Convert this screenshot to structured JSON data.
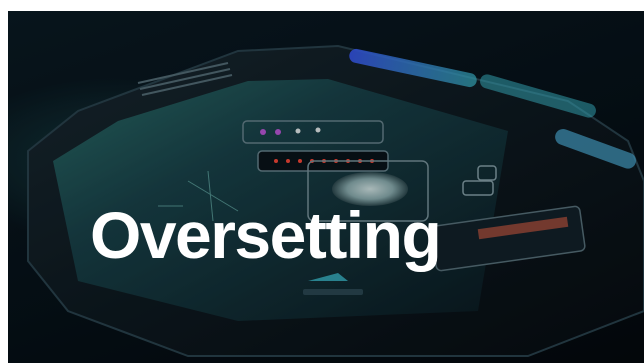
{
  "title": "Oversetting",
  "colors": {
    "background": "#07131b",
    "accent_cyan": "#3fc6d8",
    "accent_blue": "#3a5cff",
    "accent_red": "#ff4a3a",
    "title_text": "#ffffff"
  }
}
